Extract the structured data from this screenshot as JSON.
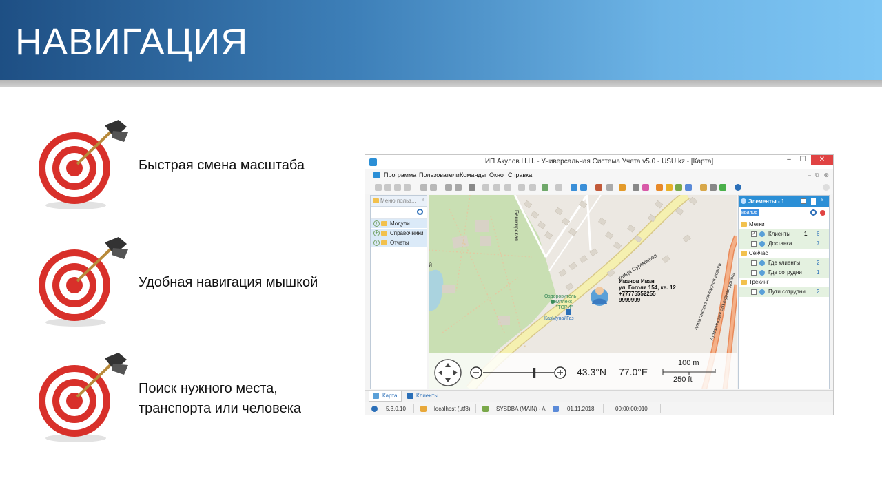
{
  "slide": {
    "title": "НАВИГАЦИЯ",
    "bullets": [
      {
        "lines": [
          "Быстрая смена масштаба"
        ]
      },
      {
        "lines": [
          "Удобная навигация мышкой"
        ]
      },
      {
        "lines": [
          "Поиск нужного места,",
          "транспорта или человека"
        ]
      }
    ]
  },
  "window": {
    "title": "ИП Акулов Н.Н. - Универсальная Система Учета v5.0 - USU.kz - [Карта]",
    "controls": {
      "minimize": "–",
      "maximize": "☐",
      "close": "✕"
    },
    "menu": [
      "Программа",
      "Пользователи",
      "Команды",
      "Окно",
      "Справка"
    ],
    "left_panel": {
      "title": "Меню польз...",
      "pin": "ª",
      "items": [
        "Модули",
        "Справочники",
        "Отчеты"
      ]
    },
    "map": {
      "person": {
        "name": "Иванов Иван",
        "address": "ул. Гоголя 154, кв. 12",
        "phone": "+77775552255",
        "code": "9999999"
      },
      "labels": {
        "street_v": "Башкирская",
        "street_diag": "улица Сурманова",
        "road_1": "Алматинская объездная дорога",
        "road_2": "Алматинская объездная дорога",
        "poi_1_a": "Оздоровитель",
        "poi_1_b": "комплекс",
        "poi_1_c": "\"ТОРИ\"",
        "poi_2": "КазМунайГаз",
        "edge": "й"
      },
      "lat": "43.3°N",
      "lon": "77.0°E",
      "scale_m": "100 m",
      "scale_ft": "250 ft",
      "zoom_level": 0.72
    },
    "right_panel": {
      "title": "Элементы - 1",
      "search": "иванов",
      "groups": [
        {
          "name": "Метки",
          "items": [
            {
              "label": "Клиенты",
              "bold": "1",
              "count": "6",
              "checked": true
            },
            {
              "label": "Доставка",
              "bold": "",
              "count": "7",
              "checked": false
            }
          ]
        },
        {
          "name": "Сейчас",
          "items": [
            {
              "label": "Где клиенты",
              "bold": "",
              "count": "2",
              "checked": false
            },
            {
              "label": "Где сотрудни",
              "bold": "",
              "count": "1",
              "checked": false
            }
          ]
        },
        {
          "name": "Трекинг",
          "items": [
            {
              "label": "Пути сотрудни",
              "bold": "",
              "count": "2",
              "checked": false
            }
          ]
        }
      ]
    },
    "tabs": [
      "Карта",
      "Клиенты"
    ],
    "status": {
      "version": "5.3.0.10",
      "server": "localhost (utf8)",
      "user": "SYSDBA (MAIN) - A",
      "date": "01.11.2018",
      "timer": "00:00:00:010"
    },
    "colors": {
      "accent": "#2b8fd6",
      "close": "#e04343",
      "park": "#c9dfb3",
      "road": "#f5f0b0"
    }
  }
}
